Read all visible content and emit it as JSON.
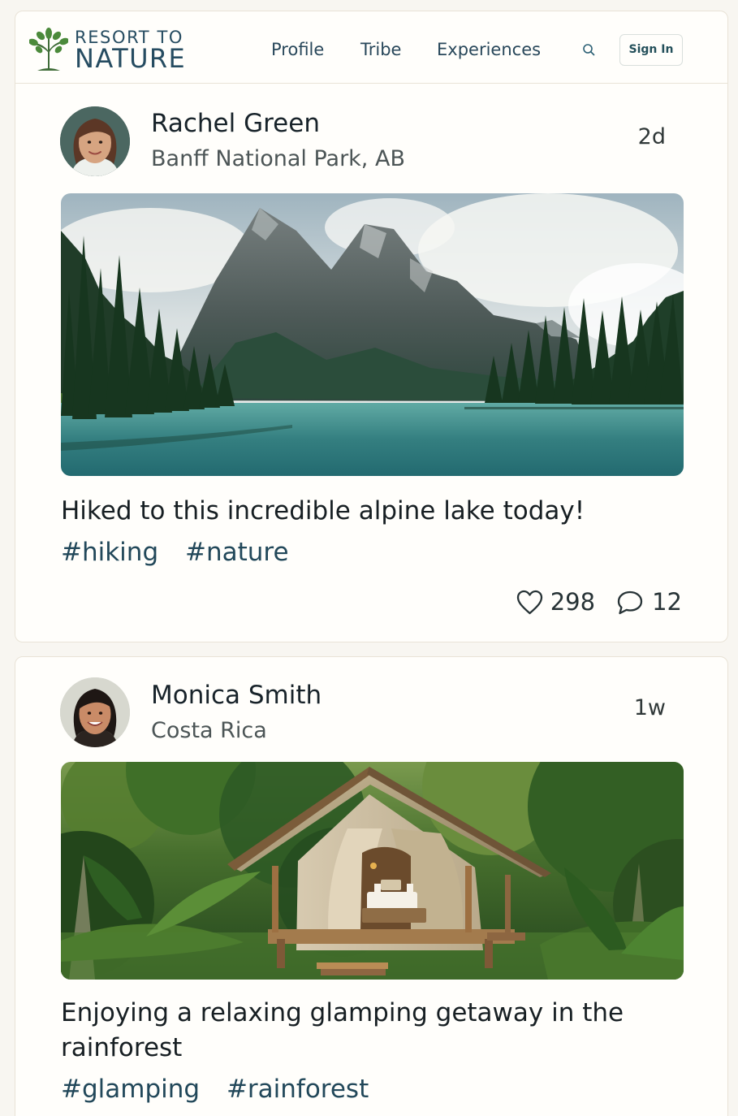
{
  "brand": {
    "name_top": "RESORT TO",
    "name_bottom": "NATURE"
  },
  "navigation": {
    "profile": "Profile",
    "tribe": "Tribe",
    "experiences": "Experiences",
    "sign_in": "Sign In"
  },
  "icons": {
    "logo": "tree-icon",
    "search": "search-icon",
    "like": "heart-icon",
    "comment": "comment-icon"
  },
  "colors": {
    "page_background": "#f8f6f1",
    "card_background": "#fffefb",
    "brand": "#264c61",
    "brand_green": "#36752f",
    "hashtag": "#22485a"
  },
  "posts": [
    {
      "author": "Rachel Green",
      "location": "Banff National Park, AB",
      "age": "2d",
      "caption": "Hiked to this incredible alpine lake today!",
      "tags": [
        "#hiking",
        "#nature"
      ],
      "likes": "298",
      "comments": "12"
    },
    {
      "author": "Monica Smith",
      "location": "Costa Rica",
      "age": "1w",
      "caption": "Enjoying a relaxing glamping getaway in the rainforest",
      "tags": [
        "#glamping",
        "#rainforest"
      ]
    }
  ]
}
